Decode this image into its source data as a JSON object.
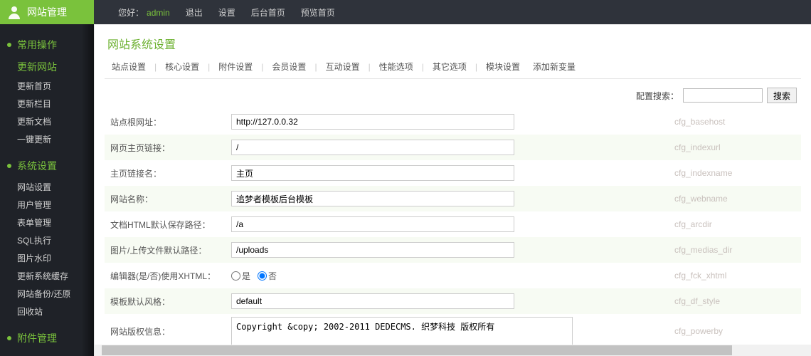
{
  "topbar": {
    "brand": "网站管理",
    "greet_prefix": "您好：",
    "admin": "admin",
    "links": [
      "退出",
      "设置",
      "后台首页",
      "预览首页"
    ]
  },
  "sidebar": {
    "sections": [
      {
        "title": "常用操作",
        "items": [
          {
            "label": "更新网站",
            "highlight": true
          },
          {
            "label": "更新首页"
          },
          {
            "label": "更新栏目"
          },
          {
            "label": "更新文档"
          },
          {
            "label": "一键更新"
          }
        ]
      },
      {
        "title": "系统设置",
        "items": [
          {
            "label": "网站设置"
          },
          {
            "label": "用户管理"
          },
          {
            "label": "表单管理"
          },
          {
            "label": "SQL执行"
          },
          {
            "label": "图片水印"
          },
          {
            "label": "更新系统缓存"
          },
          {
            "label": "网站备份/还原"
          },
          {
            "label": "回收站"
          }
        ]
      },
      {
        "title": "附件管理",
        "items": []
      }
    ]
  },
  "page": {
    "title": "网站系统设置",
    "tabs": [
      "站点设置",
      "核心设置",
      "附件设置",
      "会员设置",
      "互动设置",
      "性能选项",
      "其它选项",
      "模块设置",
      "添加新变量"
    ],
    "search_label": "配置搜索：",
    "search_btn": "搜索"
  },
  "rows": [
    {
      "label": "站点根网址：",
      "type": "text",
      "value": "http://127.0.0.32",
      "hint": "cfg_basehost"
    },
    {
      "label": "网页主页链接：",
      "type": "text",
      "value": "/",
      "hint": "cfg_indexurl"
    },
    {
      "label": "主页链接名：",
      "type": "text",
      "value": "主页",
      "hint": "cfg_indexname"
    },
    {
      "label": "网站名称：",
      "type": "text",
      "value": "追梦者模板后台模板",
      "hint": "cfg_webname"
    },
    {
      "label": "文档HTML默认保存路径：",
      "type": "text",
      "value": "/a",
      "hint": "cfg_arcdir"
    },
    {
      "label": "图片/上传文件默认路径：",
      "type": "text",
      "value": "/uploads",
      "hint": "cfg_medias_dir"
    },
    {
      "label": "编辑器(是/否)使用XHTML：",
      "type": "radio",
      "yes": "是",
      "no": "否",
      "selected": "no",
      "hint": "cfg_fck_xhtml"
    },
    {
      "label": "模板默认风格：",
      "type": "text",
      "value": "default",
      "hint": "cfg_df_style"
    },
    {
      "label": "网站版权信息：",
      "type": "textarea",
      "value": "Copyright &copy; 2002-2011 DEDECMS. 织梦科技 版权所有",
      "hint": "cfg_powerby"
    }
  ]
}
